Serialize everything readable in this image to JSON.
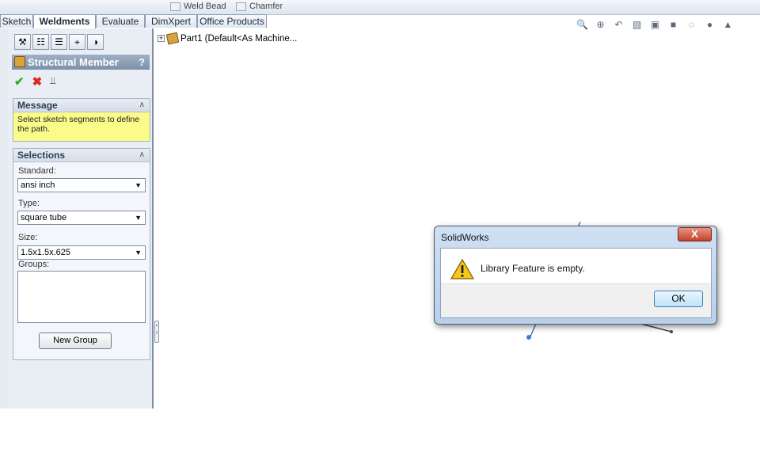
{
  "commands": {
    "weld_bead": "Weld Bead",
    "chamfer": "Chamfer"
  },
  "tabs": [
    "Sketch",
    "Weldments",
    "Evaluate",
    "DimXpert",
    "Office Products"
  ],
  "active_tab": "Weldments",
  "view_toolbar_icons": [
    "zoom-to-fit-icon",
    "zoom-to-area-icon",
    "previous-view-icon",
    "section-view-icon",
    "view-orientation-icon",
    "display-style-icon",
    "hide-show-icon",
    "edit-appearance-icon",
    "apply-scene-icon"
  ],
  "property_manager": {
    "title": "Structural Member",
    "help": "?",
    "message_group": {
      "title": "Message",
      "text": "Select sketch segments to define the path."
    },
    "selections_group": {
      "title": "Selections",
      "standard_label": "Standard:",
      "standard_value": "ansi inch",
      "type_label": "Type:",
      "type_value": "square tube",
      "size_label": "Size:",
      "size_value": "1.5x1.5x.625",
      "groups_label": "Groups:",
      "new_group_button": "New Group"
    }
  },
  "feature_tree": {
    "part_label": "Part1  (Default<As Machine..."
  },
  "dialog": {
    "title": "SolidWorks",
    "close": "X",
    "message": "Library Feature is empty.",
    "ok": "OK"
  },
  "colors": {
    "message_bg": "#fbfb8a",
    "title_bar": "#8c9eb6",
    "sketch_line": "#3a7bd5"
  }
}
